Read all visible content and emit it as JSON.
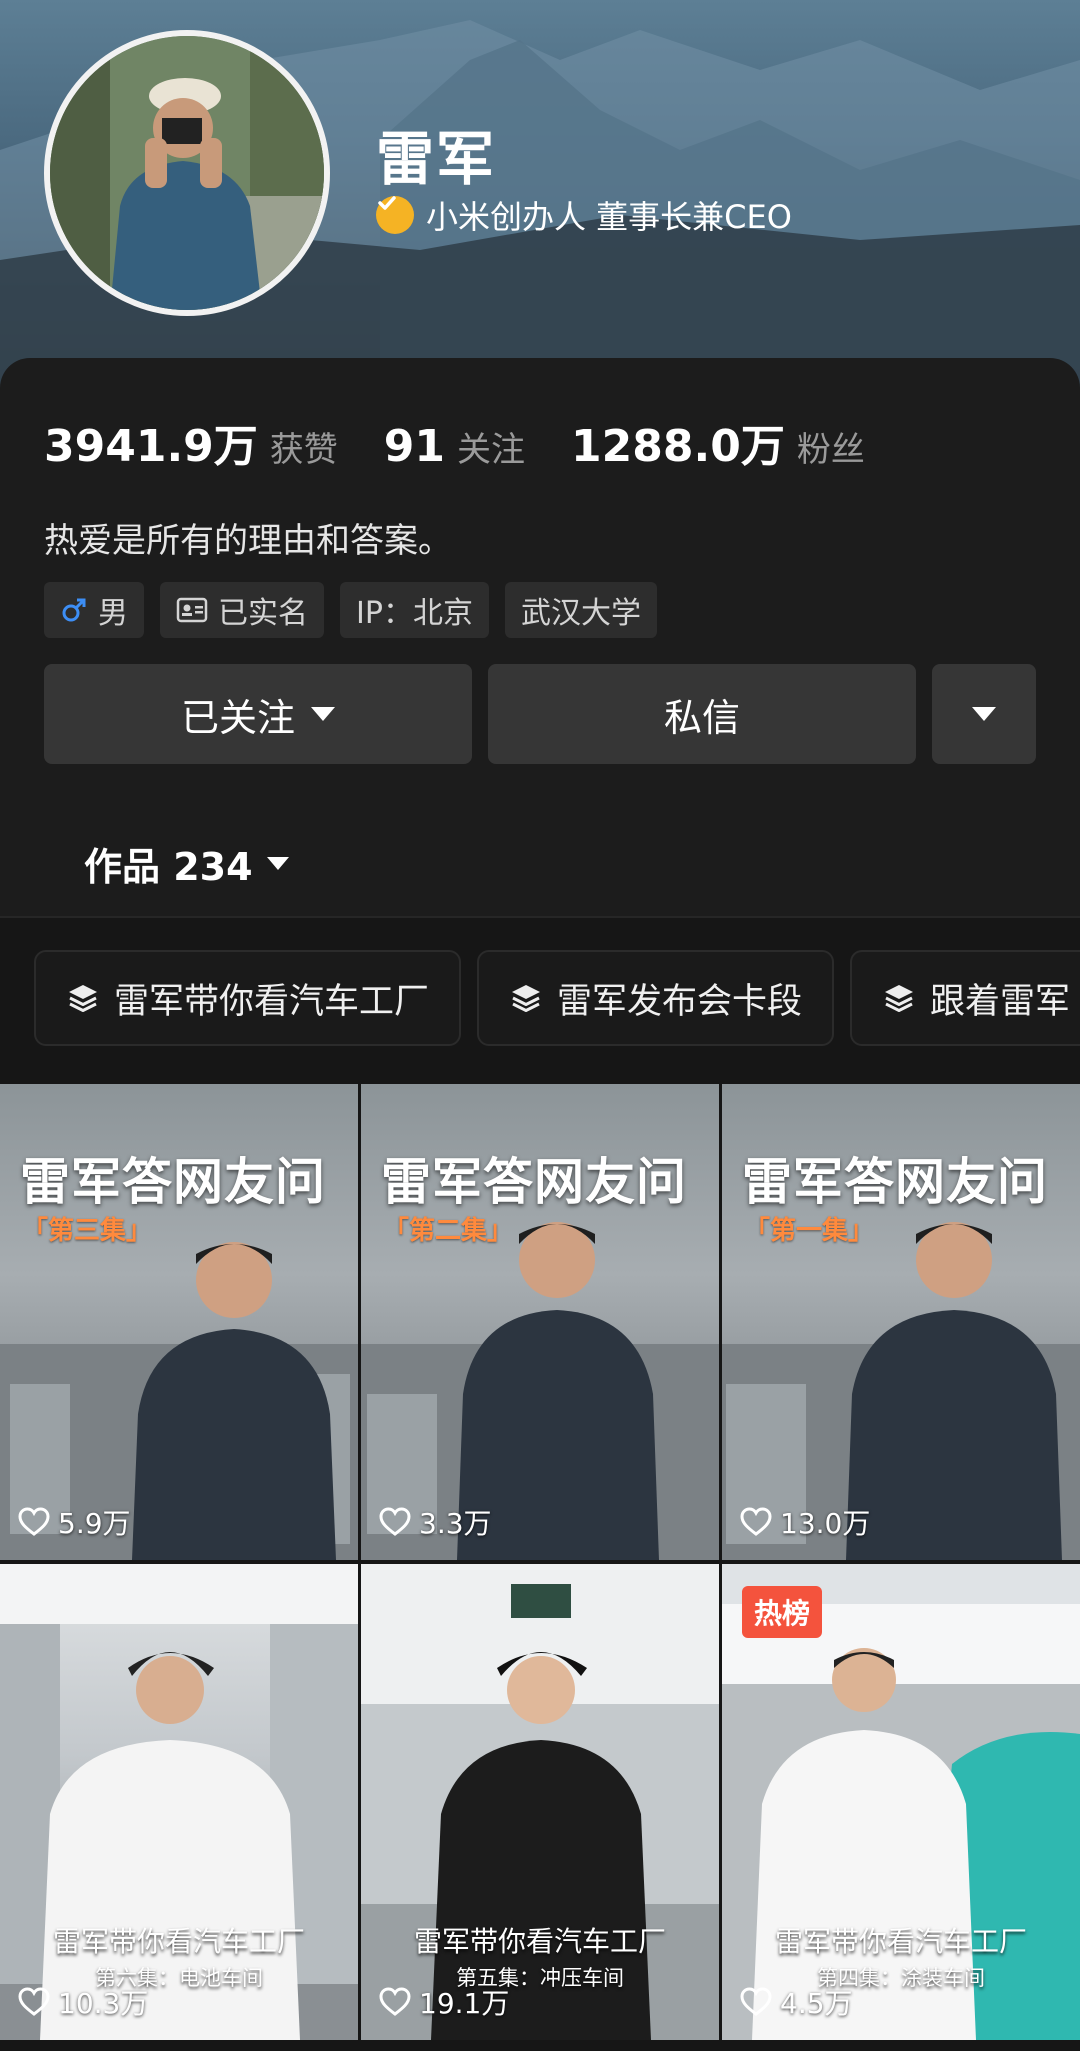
{
  "profile": {
    "name": "雷军",
    "verified_title": "小米创办人 董事长兼CEO",
    "bio": "热爱是所有的理由和答案。",
    "stats": [
      {
        "value": "3941.9万",
        "label": "获赞"
      },
      {
        "value": "91",
        "label": "关注"
      },
      {
        "value": "1288.0万",
        "label": "粉丝"
      }
    ],
    "tags": [
      {
        "icon": "male-icon",
        "label": "男"
      },
      {
        "icon": "id-card-icon",
        "label": "已实名"
      },
      {
        "label": "IP：北京"
      },
      {
        "label": "武汉大学"
      }
    ]
  },
  "actions": {
    "follow_label": "已关注",
    "message_label": "私信"
  },
  "works_tab": {
    "label": "作品 234"
  },
  "collections": [
    {
      "icon": "layers-icon",
      "label": "雷军带你看汽车工厂"
    },
    {
      "icon": "layers-icon",
      "label": "雷军发布会卡段"
    },
    {
      "icon": "layers-icon",
      "label": "跟着雷军"
    }
  ],
  "videos": [
    {
      "title": "雷军答网友问",
      "episode": "「第三集」",
      "likes": "5.9万"
    },
    {
      "title": "雷军答网友问",
      "episode": "「第二集」",
      "likes": "3.3万"
    },
    {
      "title": "雷军答网友问",
      "episode": "「第一集」",
      "likes": "13.0万"
    },
    {
      "caption": "雷军带你看汽车工厂",
      "subcaption": "第六集：电池车间",
      "likes": "10.3万"
    },
    {
      "caption": "雷军带你看汽车工厂",
      "subcaption": "第五集：冲压车间",
      "likes": "19.1万"
    },
    {
      "badge": "热榜",
      "caption": "雷军带你看汽车工厂",
      "subcaption": "第四集：涂装车间",
      "likes": "4.5万"
    }
  ],
  "colors": {
    "verify_badge": "#f5b324",
    "episode_text": "#ff8a3d",
    "hot_badge": "#f4533d",
    "male_icon": "#3d8ef5"
  }
}
